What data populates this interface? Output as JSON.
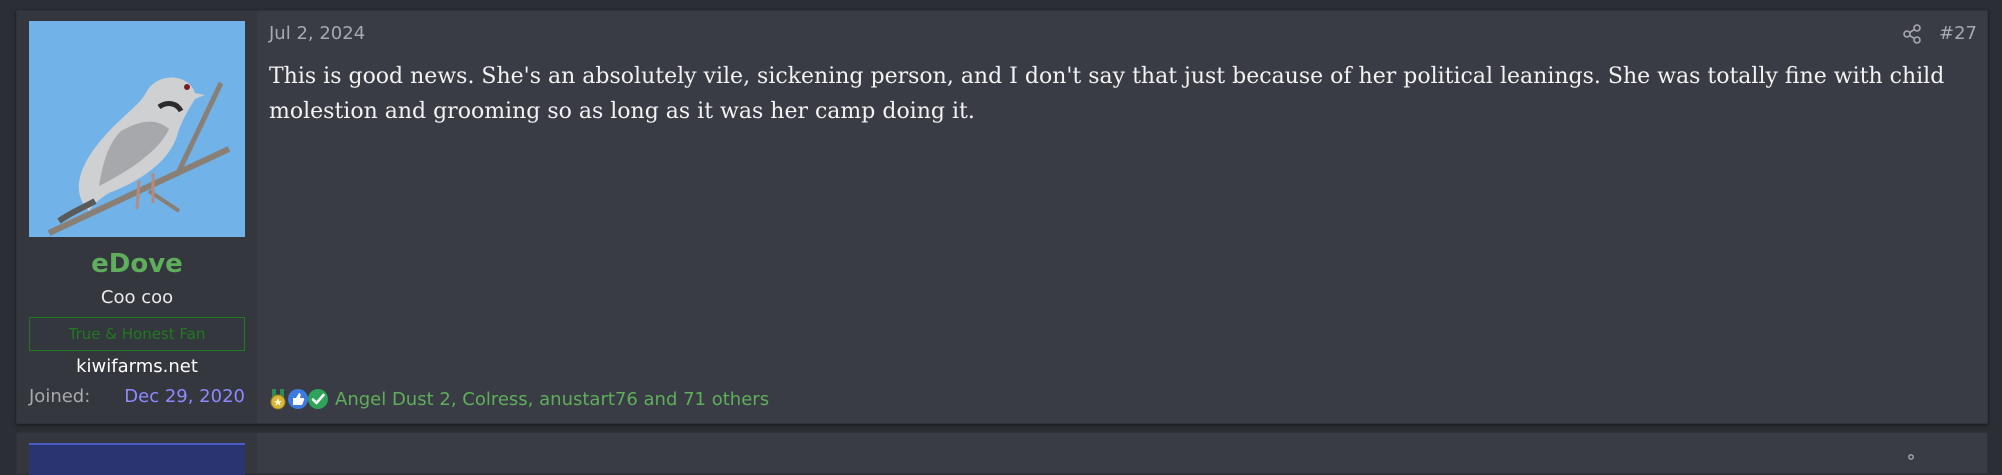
{
  "post": {
    "date": "Jul 2, 2024",
    "number": "#27",
    "message": "This is good news. She's an absolutely vile, sickening person, and I don't say that just because of her political leanings. She was totally fine with child molestion and grooming so as long as it was her camp doing it.",
    "reactions_text": "Angel Dust 2, Colress, anustart76 and 71 others"
  },
  "user": {
    "name": "eDove",
    "title": "Coo coo",
    "banner": "True & Honest Fan",
    "site": "kiwifarms.net",
    "joined_label": "Joined:",
    "joined_value": "Dec 29, 2020"
  },
  "icons": {
    "share": "share-icon",
    "reaction_1": "medal-icon",
    "reaction_2": "thumbs-up-icon",
    "reaction_3": "checkmark-icon"
  },
  "colors": {
    "username": "#5fae5b",
    "banner": "#1f7a1f",
    "joined_date": "#8e89ff",
    "reaction_text": "#5fae5b",
    "post_bg": "#393c44",
    "user_col_bg": "#34373e"
  }
}
